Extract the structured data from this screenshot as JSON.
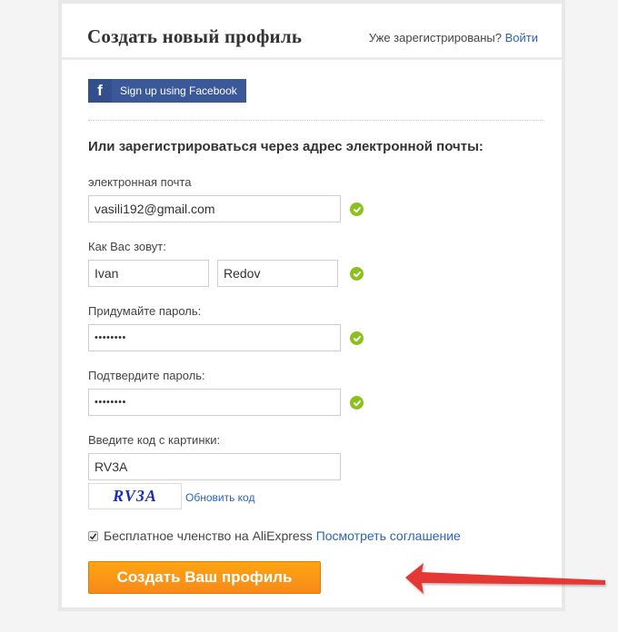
{
  "header": {
    "title": "Создать новый профиль",
    "signin_prompt": "Уже зарегистрированы?",
    "signin_link": "Войти"
  },
  "facebook": {
    "icon": "facebook-icon",
    "label": "Sign up using Facebook"
  },
  "form": {
    "subhead": "Или зарегистрироваться через адрес электронной почты:",
    "email": {
      "label": "электронная почта",
      "value": "vasili192@gmail.com",
      "valid": true
    },
    "name": {
      "label": "Как Вас зовут:",
      "first": "Ivan",
      "last": "Redov",
      "valid": true
    },
    "password": {
      "label": "Придумайте пароль:",
      "value": "••••••••",
      "valid": true
    },
    "confirm": {
      "label": "Подтвердите пароль:",
      "value": "••••••••",
      "valid": true
    },
    "captcha": {
      "label": "Введите код с картинки:",
      "value": "RV3A",
      "image_text": "RV3A",
      "refresh_link": "Обновить код"
    },
    "agreement": {
      "checked": true,
      "text": "Бесплатное членство на AliExpress",
      "link": "Посмотреть соглашение"
    },
    "submit_label": "Создать Ваш профиль"
  },
  "colors": {
    "accent_orange": "#f7941d",
    "link_blue": "#2c64b8",
    "facebook_blue": "#3b5998",
    "valid_green": "#8cc11d",
    "annotation_red": "#e53935"
  }
}
